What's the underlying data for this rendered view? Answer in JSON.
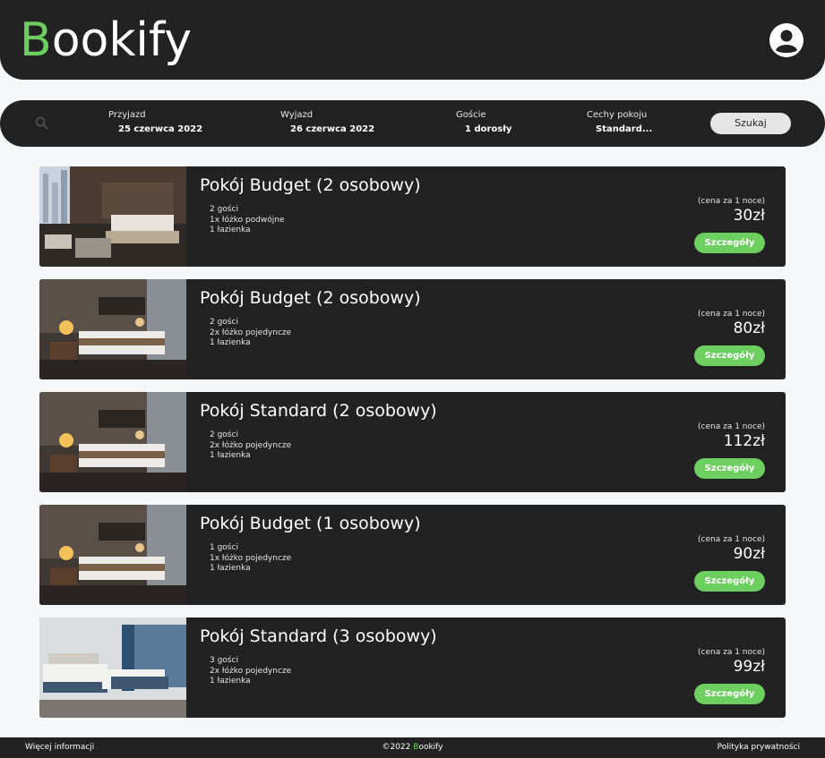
{
  "header": {
    "logo_first": "B",
    "logo_rest": "ookify",
    "account_icon": "account-circle-icon"
  },
  "search": {
    "search_icon": "search-icon",
    "arrive_label": "Przyjazd",
    "arrive_value": "25 czerwca 2022",
    "depart_label": "Wyjazd",
    "depart_value": "26 czerwca 2022",
    "guests_label": "Goście",
    "guests_value": "1 dorosły",
    "features_label": "Cechy pokoju",
    "features_value": "Standard...",
    "button_label": "Szukaj"
  },
  "rooms": [
    {
      "title": "Pokój Budget (2 osobowy)",
      "guests": "2 gości",
      "beds": "1x łóżko podwójne",
      "bathrooms": "1 łazienka",
      "price_note": "(cena za 1 noce)",
      "price": "30zł",
      "button": "Szczegóły",
      "photo": "city-view-bedroom"
    },
    {
      "title": "Pokój Budget (2 osobowy)",
      "guests": "2 gości",
      "beds": "2x łóżko pojedyncze",
      "bathrooms": "1 łazienka",
      "price_note": "(cena za 1 noce)",
      "price": "80zł",
      "button": "Szczegóły",
      "photo": "hotel-bedroom-lamps"
    },
    {
      "title": "Pokój Standard (2 osobowy)",
      "guests": "2 gości",
      "beds": "2x łóżko pojedyncze",
      "bathrooms": "1 łazienka",
      "price_note": "(cena za 1 noce)",
      "price": "112zł",
      "button": "Szczegóły",
      "photo": "hotel-bedroom-lamps"
    },
    {
      "title": "Pokój Budget (1 osobowy)",
      "guests": "1 gości",
      "beds": "1x łóżko pojedyncze",
      "bathrooms": "1 łazienka",
      "price_note": "(cena za 1 noce)",
      "price": "90zł",
      "button": "Szczegóły",
      "photo": "hotel-bedroom-lamps"
    },
    {
      "title": "Pokój Standard (3 osobowy)",
      "guests": "3 gości",
      "beds": "2x łóżko pojedyncze",
      "bathrooms": "1 łazienka",
      "price_note": "(cena za 1 noce)",
      "price": "99zł",
      "button": "Szczegóły",
      "photo": "twin-bedroom-window"
    }
  ],
  "footer": {
    "more_info": "Więcej informacji",
    "copyright_prefix": "©2022 ",
    "brand_first": "B",
    "brand_rest": "ookify",
    "privacy": "Polityka prywatności"
  },
  "colors": {
    "accent": "#6ccf5f",
    "panel": "#222222",
    "background": "#f6f7f9"
  }
}
